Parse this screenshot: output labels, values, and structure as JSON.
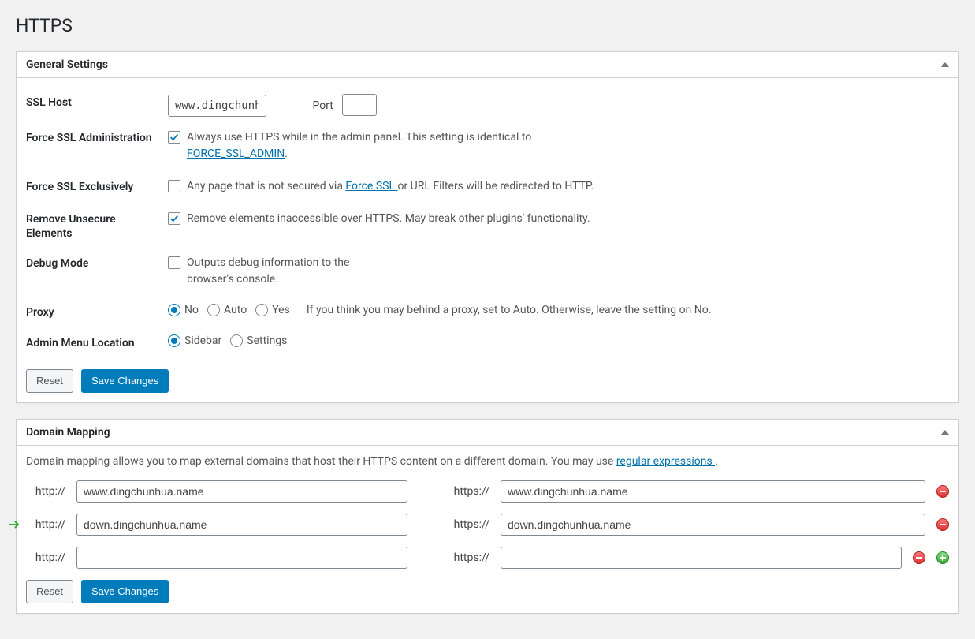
{
  "page_title": "HTTPS",
  "general": {
    "header": "General Settings",
    "rows": {
      "ssl_host": {
        "label": "SSL Host",
        "value": "www.dingchunhu",
        "port_label": "Port",
        "port_value": ""
      },
      "force_ssl_admin": {
        "label": "Force SSL Administration",
        "desc_pre": "Always use HTTPS while in the admin panel. This setting is identical to ",
        "link": "FORCE_SSL_ADMIN",
        "desc_post": "."
      },
      "force_ssl_excl": {
        "label": "Force SSL Exclusively",
        "desc_pre": "Any page that is not secured via ",
        "link": "Force SSL ",
        "desc_post": "or URL Filters will be redirected to HTTP."
      },
      "remove_unsecure": {
        "label": "Remove Unsecure Elements",
        "desc": "Remove elements inaccessible over HTTPS. May break other plugins' functionality."
      },
      "debug": {
        "label": "Debug Mode",
        "desc": "Outputs debug information to the browser's console."
      },
      "proxy": {
        "label": "Proxy",
        "opt_no": "No",
        "opt_auto": "Auto",
        "opt_yes": "Yes",
        "help": "If you think you may behind a proxy, set to Auto. Otherwise, leave the setting on No."
      },
      "admin_menu": {
        "label": "Admin Menu Location",
        "opt_sidebar": "Sidebar",
        "opt_settings": "Settings"
      }
    },
    "reset": "Reset",
    "save": "Save Changes"
  },
  "mapping": {
    "header": "Domain Mapping",
    "desc_pre": "Domain mapping allows you to map external domains that host their HTTPS content on a different domain. You may use ",
    "desc_link": "regular expressions ",
    "desc_post": ".",
    "http_label": "http://",
    "https_label": "https://",
    "rows": [
      {
        "http": "www.dingchunhua.name",
        "https": "www.dingchunhua.name"
      },
      {
        "http": "down.dingchunhua.name",
        "https": "down.dingchunhua.name"
      },
      {
        "http": "",
        "https": ""
      }
    ],
    "reset": "Reset",
    "save": "Save Changes"
  }
}
